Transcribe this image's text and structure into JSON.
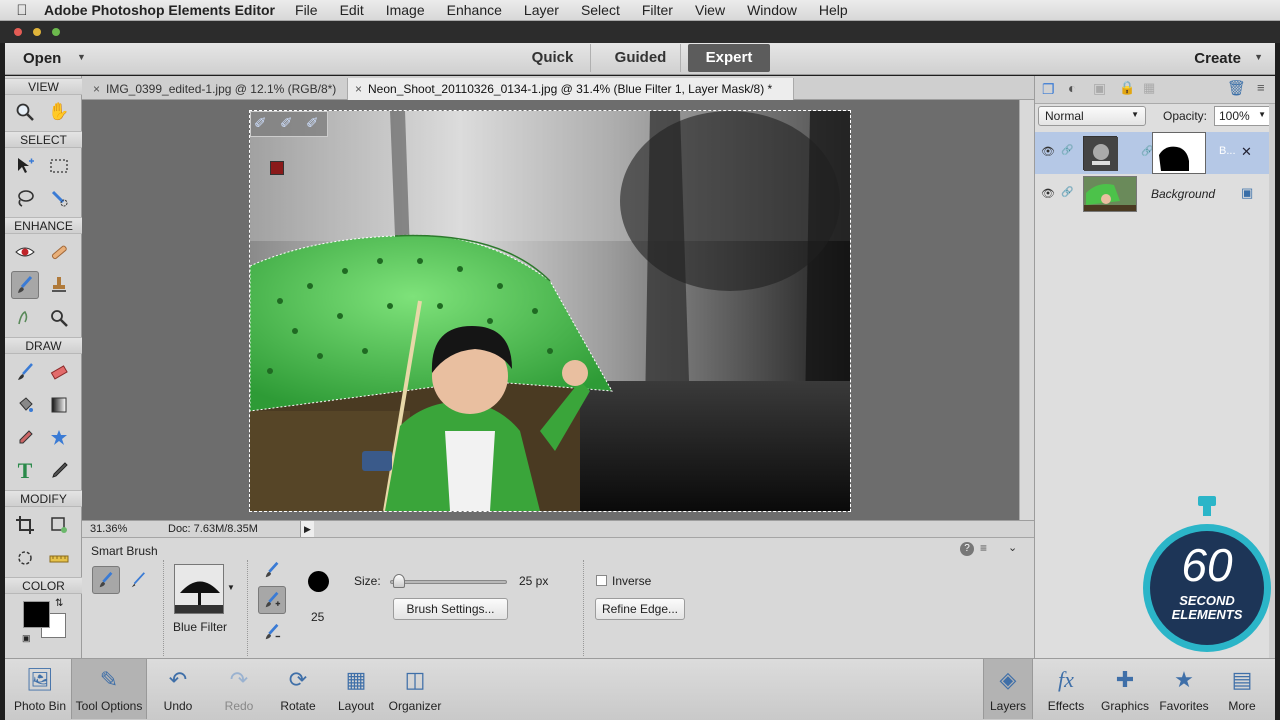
{
  "menubar": {
    "app_name": "Adobe Photoshop Elements Editor",
    "items": [
      "File",
      "Edit",
      "Image",
      "Enhance",
      "Layer",
      "Select",
      "Filter",
      "View",
      "Window",
      "Help"
    ]
  },
  "modebar": {
    "open_label": "Open",
    "tabs": [
      {
        "label": "Quick"
      },
      {
        "label": "Guided"
      },
      {
        "label": "Expert"
      }
    ],
    "create_label": "Create"
  },
  "toolbox": {
    "sections": {
      "view": "VIEW",
      "select": "SELECT",
      "enhance": "ENHANCE",
      "draw": "DRAW",
      "modify": "MODIFY",
      "color": "COLOR"
    }
  },
  "doctabs": [
    {
      "title": "IMG_0399_edited-1.jpg @ 12.1% (RGB/8*)"
    },
    {
      "title": "Neon_Shoot_20110326_0134-1.jpg @ 31.4% (Blue Filter 1, Layer Mask/8) *"
    }
  ],
  "status": {
    "zoom": "31.36%",
    "doc": "Doc: 7.63M/8.35M"
  },
  "tooloptions": {
    "title": "Smart Brush",
    "preset_label": "Blue Filter",
    "brush_size_small": "25",
    "size_label": "Size:",
    "size_value": "25 px",
    "size_fraction": 0.08,
    "brush_settings": "Brush Settings...",
    "inverse_label": "Inverse",
    "refine_edge": "Refine Edge..."
  },
  "layers_panel": {
    "blend_mode": "Normal",
    "opacity_label": "Opacity:",
    "opacity_value": "100%",
    "layers": [
      {
        "name": "B..."
      },
      {
        "name": "Background"
      }
    ]
  },
  "bottombar": {
    "left": [
      {
        "label": "Photo Bin",
        "icon": "photo-bin-icon"
      },
      {
        "label": "Tool Options",
        "icon": "tool-options-icon"
      },
      {
        "label": "Undo",
        "icon": "undo-icon"
      },
      {
        "label": "Redo",
        "icon": "redo-icon"
      },
      {
        "label": "Rotate",
        "icon": "rotate-icon"
      },
      {
        "label": "Layout",
        "icon": "layout-icon"
      },
      {
        "label": "Organizer",
        "icon": "organizer-icon"
      }
    ],
    "right": [
      {
        "label": "Layers",
        "icon": "layers-icon"
      },
      {
        "label": "Effects",
        "icon": "fx-icon"
      },
      {
        "label": "Graphics",
        "icon": "plus-icon"
      },
      {
        "label": "Favorites",
        "icon": "star-icon"
      },
      {
        "label": "More",
        "icon": "more-icon"
      }
    ]
  },
  "watermark": {
    "number": "60",
    "line1": "SECOND",
    "line2": "ELEMENTS"
  },
  "colors": {
    "accent_green": "#4cc24a",
    "watermark_teal": "#2bb5c8",
    "watermark_navy": "#1d3557"
  }
}
